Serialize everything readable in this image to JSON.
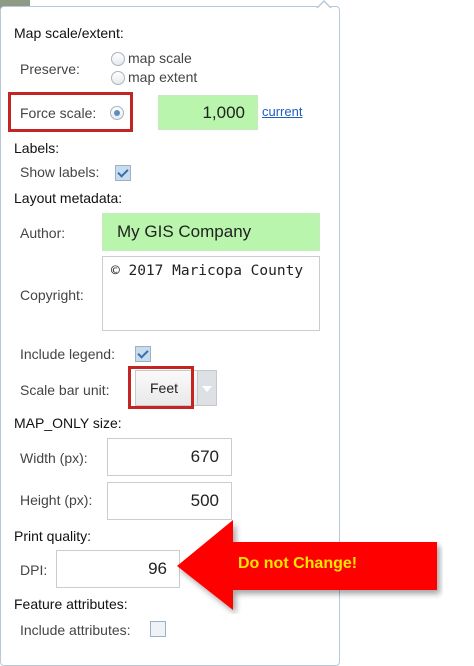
{
  "map_scale": {
    "section_title": "Map scale/extent:",
    "preserve_label": "Preserve:",
    "options": [
      "map scale",
      "map extent"
    ],
    "force_scale_label": "Force scale:",
    "scale_value": "1,000",
    "current_link": "current"
  },
  "labels": {
    "section_title": "Labels:",
    "show_labels_label": "Show labels:"
  },
  "layout_metadata": {
    "section_title": "Layout metadata:",
    "author_label": "Author:",
    "author_value": "My GIS Company",
    "copyright_label": "Copyright:",
    "copyright_value": "© 2017 Maricopa County",
    "include_legend_label": "Include legend:",
    "scale_bar_unit_label": "Scale bar unit:",
    "scale_bar_unit_value": "Feet"
  },
  "map_only_size": {
    "section_title": "MAP_ONLY size:",
    "width_label": "Width (px):",
    "width_value": "670",
    "height_label": "Height (px):",
    "height_value": "500"
  },
  "print_quality": {
    "section_title": "Print quality:",
    "dpi_label": "DPI:",
    "dpi_value": "96"
  },
  "feature_attributes": {
    "section_title": "Feature attributes:",
    "include_attributes_label": "Include attributes:"
  },
  "annotation": {
    "callout_text": "Do not Change!",
    "highlight_color": "#c42424",
    "arrow_color": "#ff0000",
    "text_color": "#ffe600"
  }
}
